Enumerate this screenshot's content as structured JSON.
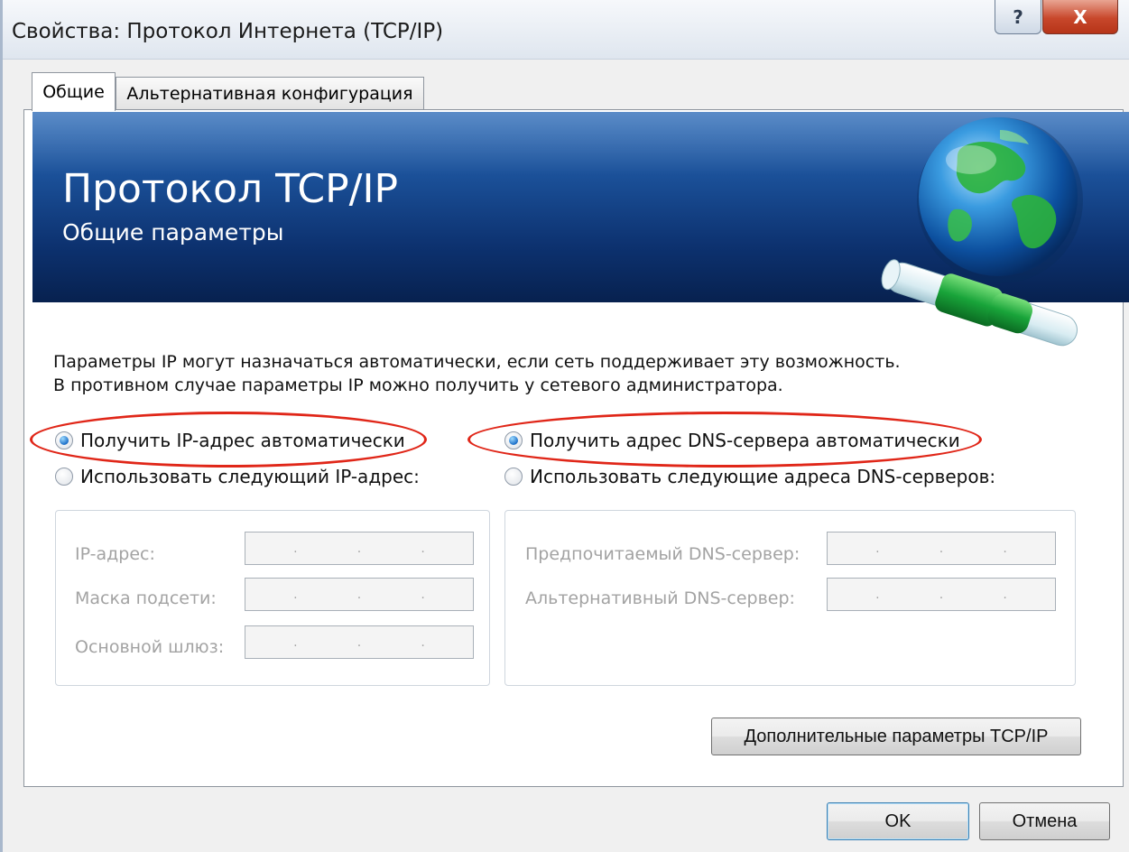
{
  "window": {
    "title": "Свойства: Протокол Интернета (TCP/IP)",
    "help_label": "?",
    "close_label": "X"
  },
  "tabs": [
    {
      "label": "Общие",
      "active": true
    },
    {
      "label": "Альтернативная конфигурация",
      "active": false
    }
  ],
  "banner": {
    "title": "Протокол TCP/IP",
    "subtitle": "Общие параметры"
  },
  "description": {
    "line1": "Параметры IP могут назначаться автоматически, если сеть поддерживает эту возможность.",
    "line2": "В противном случае параметры IP можно получить у сетевого администратора."
  },
  "ip_options": {
    "auto": {
      "label": "Получить IP-адрес автоматически",
      "checked": true
    },
    "manual": {
      "label": "Использовать следующий IP-адрес:",
      "checked": false
    }
  },
  "dns_options": {
    "auto": {
      "label": "Получить адрес DNS-сервера автоматически",
      "checked": true
    },
    "manual": {
      "label": "Использовать следующие адреса DNS-серверов:",
      "checked": false
    }
  },
  "ip_fields": {
    "ip_address": {
      "label": "IP-адрес:",
      "value": ""
    },
    "subnet_mask": {
      "label": "Маска подсети:",
      "value": ""
    },
    "gateway": {
      "label": "Основной шлюз:",
      "value": ""
    }
  },
  "dns_fields": {
    "preferred": {
      "label": "Предпочитаемый DNS-сервер:",
      "value": ""
    },
    "alternate": {
      "label": "Альтернативный DNS-сервер:",
      "value": ""
    }
  },
  "buttons": {
    "advanced": "Дополнительные параметры TCP/IP",
    "ok": "OK",
    "cancel": "Отмена"
  },
  "colors": {
    "highlight_oval": "#e02618",
    "banner_top": "#2c6bb8",
    "banner_bottom": "#07214f",
    "close_button": "#c8472b"
  },
  "icons": {
    "banner_graphic": "globe-with-network-cable-icon"
  }
}
